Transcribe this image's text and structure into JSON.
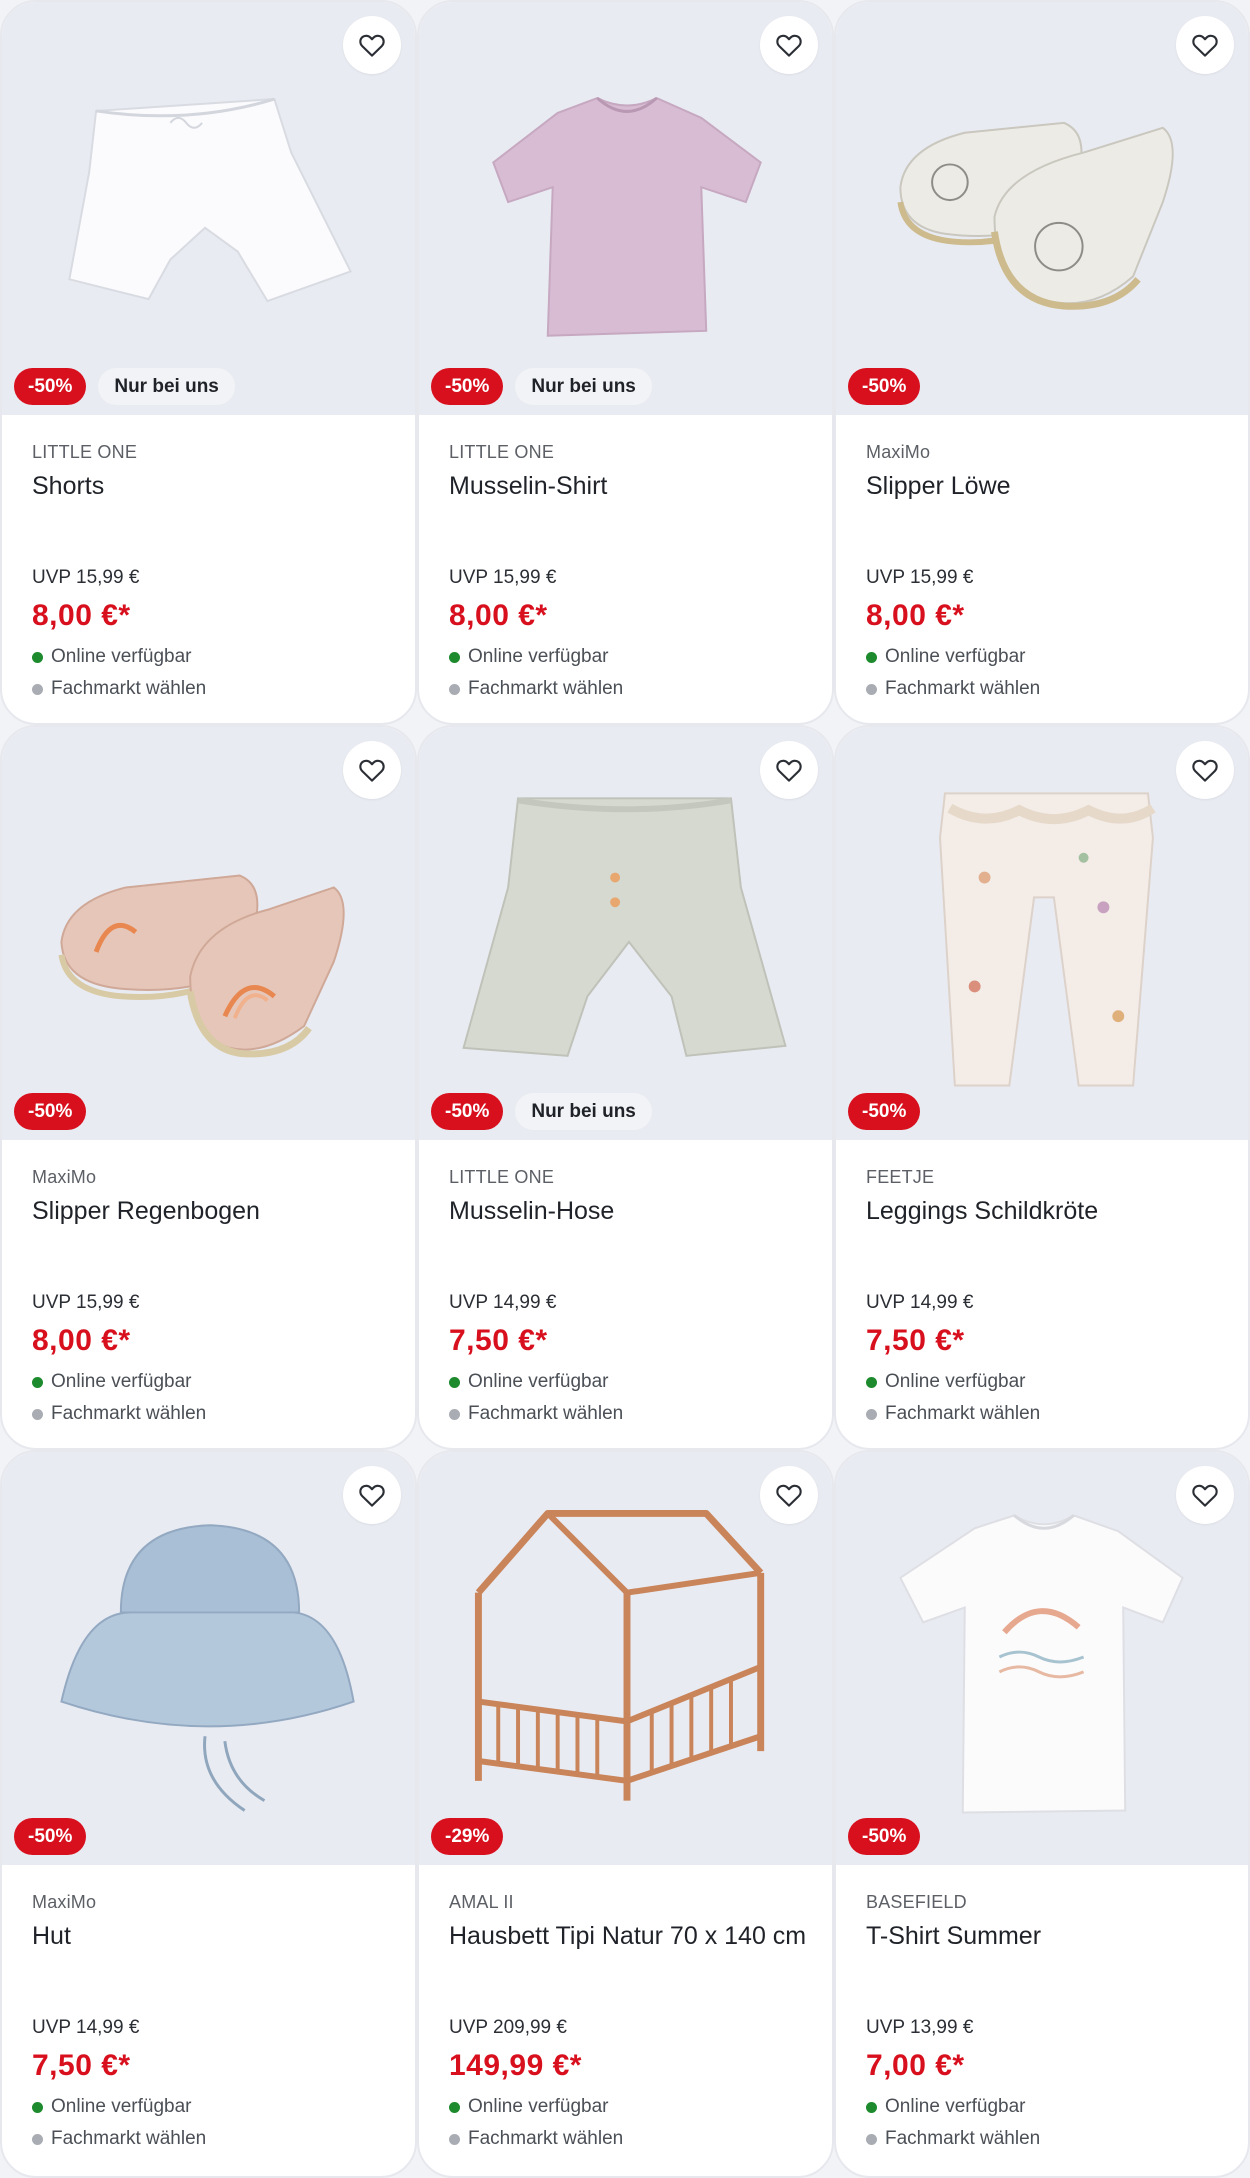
{
  "colors": {
    "discount_badge": "#d8101e",
    "price": "#d8101e",
    "available_dot": "#1d8a2d",
    "store_dot": "#a9adb3",
    "media_bg": "#e9ebf2"
  },
  "products": [
    {
      "brand": "LITTLE ONE",
      "name": "Shorts",
      "discount": "-50%",
      "exclusive": "Nur bei uns",
      "uvp": "UVP 15,99 €",
      "price": "8,00 €*",
      "online": "Online verfügbar",
      "store": "Fachmarkt wählen",
      "favorite_icon": "heart-outline-icon"
    },
    {
      "brand": "LITTLE ONE",
      "name": "Musselin-Shirt",
      "discount": "-50%",
      "exclusive": "Nur bei uns",
      "uvp": "UVP 15,99 €",
      "price": "8,00 €*",
      "online": "Online verfügbar",
      "store": "Fachmarkt wählen",
      "favorite_icon": "heart-outline-icon"
    },
    {
      "brand": "MaxiMo",
      "name": "Slipper Löwe",
      "discount": "-50%",
      "exclusive": "",
      "uvp": "UVP 15,99 €",
      "price": "8,00 €*",
      "online": "Online verfügbar",
      "store": "Fachmarkt wählen",
      "favorite_icon": "heart-outline-icon"
    },
    {
      "brand": "MaxiMo",
      "name": "Slipper Regenbogen",
      "discount": "-50%",
      "exclusive": "",
      "uvp": "UVP 15,99 €",
      "price": "8,00 €*",
      "online": "Online verfügbar",
      "store": "Fachmarkt wählen",
      "favorite_icon": "heart-outline-icon"
    },
    {
      "brand": "LITTLE ONE",
      "name": "Musselin-Hose",
      "discount": "-50%",
      "exclusive": "Nur bei uns",
      "uvp": "UVP 14,99 €",
      "price": "7,50 €*",
      "online": "Online verfügbar",
      "store": "Fachmarkt wählen",
      "favorite_icon": "heart-outline-icon"
    },
    {
      "brand": "FEETJE",
      "name": "Leggings Schildkröte",
      "discount": "-50%",
      "exclusive": "",
      "uvp": "UVP 14,99 €",
      "price": "7,50 €*",
      "online": "Online verfügbar",
      "store": "Fachmarkt wählen",
      "favorite_icon": "heart-outline-icon"
    },
    {
      "brand": "MaxiMo",
      "name": "Hut",
      "discount": "-50%",
      "exclusive": "",
      "uvp": "UVP 14,99 €",
      "price": "7,50 €*",
      "online": "Online verfügbar",
      "store": "Fachmarkt wählen",
      "favorite_icon": "heart-outline-icon"
    },
    {
      "brand": "AMAL II",
      "name": "Hausbett Tipi Natur 70 x 140 cm",
      "discount": "-29%",
      "exclusive": "",
      "uvp": "UVP 209,99 €",
      "price": "149,99 €*",
      "online": "Online verfügbar",
      "store": "Fachmarkt wählen",
      "favorite_icon": "heart-outline-icon"
    },
    {
      "brand": "BASEFIELD",
      "name": "T-Shirt Summer",
      "discount": "-50%",
      "exclusive": "",
      "uvp": "UVP 13,99 €",
      "price": "7,00 €*",
      "online": "Online verfügbar",
      "store": "Fachmarkt wählen",
      "favorite_icon": "heart-outline-icon"
    }
  ]
}
